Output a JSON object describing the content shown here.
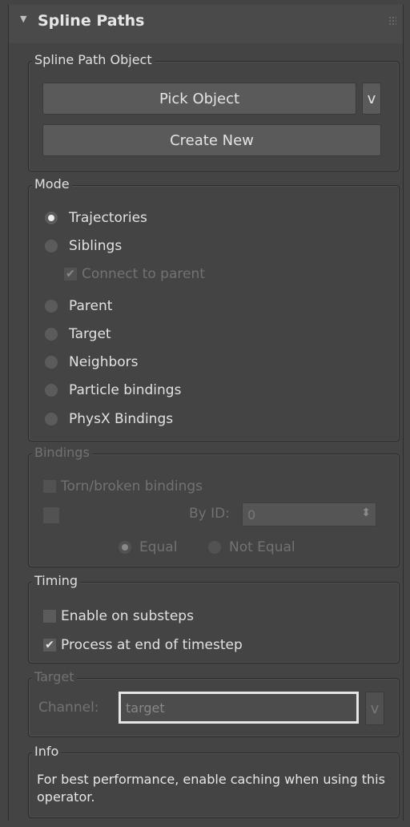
{
  "rollout": {
    "title": "Spline Paths"
  },
  "spline_path_object": {
    "label": "Spline Path Object",
    "pick_object": "Pick Object",
    "pick_menu": "v",
    "create_new": "Create New"
  },
  "mode": {
    "label": "Mode",
    "trajectories": "Trajectories",
    "siblings": "Siblings",
    "connect_to_parent": "Connect to parent",
    "connect_check": "✔",
    "parent": "Parent",
    "target": "Target",
    "neighbors": "Neighbors",
    "particle_bindings": "Particle bindings",
    "physx_bindings": "PhysX Bindings",
    "selected": "trajectories"
  },
  "bindings": {
    "label": "Bindings",
    "torn_broken": "Torn/broken bindings",
    "by_id_label": "By ID:",
    "by_id_value": "0",
    "spinner": "⬍",
    "equal": "Equal",
    "not_equal": "Not Equal"
  },
  "timing": {
    "label": "Timing",
    "enable_on_substeps": "Enable on substeps",
    "process_at_end": "Process at end of timestep",
    "process_check": "✔"
  },
  "target_group": {
    "label": "Target",
    "channel_label": "Channel:",
    "channel_value": "target",
    "channel_menu": "v"
  },
  "info": {
    "label": "Info",
    "text": "For best performance, enable caching when using this operator."
  },
  "colors": {
    "background": "#444444",
    "button": "#5a5a5a",
    "text": "#e2e2e2",
    "disabled_text": "#727272"
  }
}
